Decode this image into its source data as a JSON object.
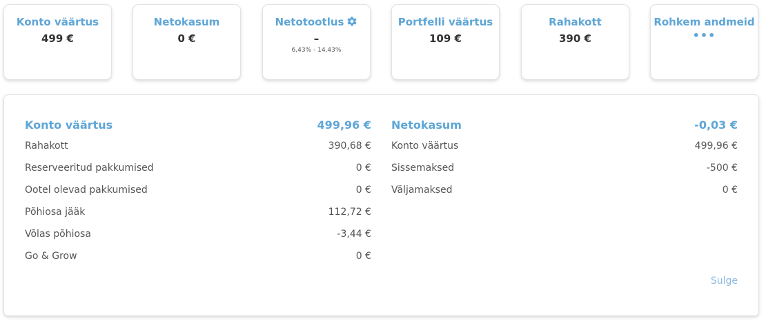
{
  "cards": [
    {
      "title": "Konto väärtus",
      "value": "499 €"
    },
    {
      "title": "Netokasum",
      "value": "0 €"
    },
    {
      "title": "Netotootlus",
      "value": "–",
      "sub": "6,43% - 14,43%",
      "icon": "gear-icon"
    },
    {
      "title": "Portfelli väärtus",
      "value": "109 €"
    },
    {
      "title": "Rahakott",
      "value": "390 €"
    },
    {
      "title": "Rohkem andmeid",
      "value": "•••"
    }
  ],
  "details": {
    "left": {
      "title": "Konto väärtus",
      "total": "499,96 €",
      "rows": [
        {
          "label": "Rahakott",
          "value": "390,68 €"
        },
        {
          "label": "Reserveeritud pakkumised",
          "value": "0 €"
        },
        {
          "label": "Ootel olevad pakkumised",
          "value": "0 €"
        },
        {
          "label": "Põhiosa jääk",
          "value": "112,72 €"
        },
        {
          "label": "Võlas põhiosa",
          "value": "-3,44 €"
        },
        {
          "label": "Go & Grow",
          "value": "0 €"
        }
      ]
    },
    "right": {
      "title": "Netokasum",
      "total": "-0,03 €",
      "rows": [
        {
          "label": "Konto väärtus",
          "value": "499,96 €"
        },
        {
          "label": "Sissemaksed",
          "value": "-500 €"
        },
        {
          "label": "Väljamaksed",
          "value": "0 €"
        }
      ]
    },
    "close_label": "Sulge"
  },
  "colors": {
    "accent": "#5ea6d6",
    "text": "#333333",
    "muted": "#555555",
    "link": "#8ab9e0"
  }
}
